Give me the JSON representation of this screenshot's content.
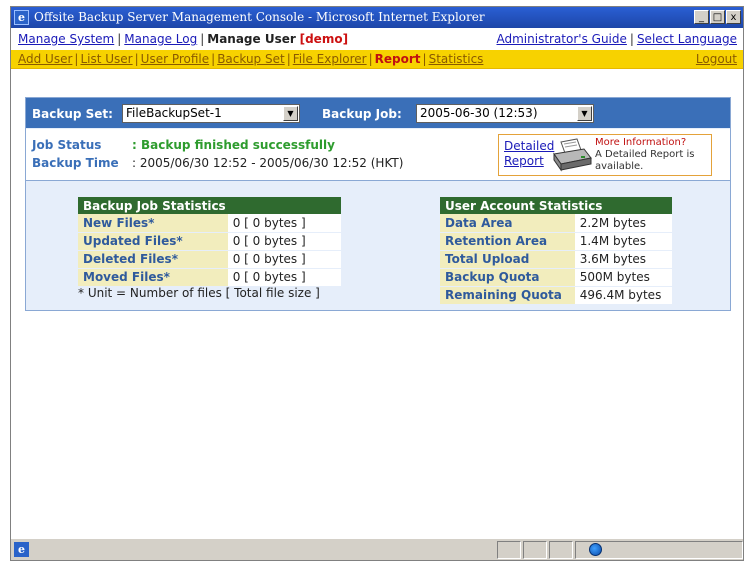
{
  "window": {
    "title": "Offsite Backup Server Management Console - Microsoft Internet Explorer",
    "controls": [
      "_",
      "□",
      "x"
    ]
  },
  "nav_top": {
    "manage_system": "Manage System",
    "manage_log": "Manage Log",
    "manage_user": "Manage User",
    "user": "demo",
    "admin_guide": "Administrator's Guide",
    "select_language": "Select Language"
  },
  "nav_sub": {
    "items": [
      "Add User",
      "List User",
      "User Profile",
      "Backup Set",
      "File Explorer",
      "Report",
      "Statistics"
    ],
    "active": "Report",
    "logout": "Logout"
  },
  "filters": {
    "backup_set_label": "Backup Set:",
    "backup_set_value": "FileBackupSet-1",
    "backup_job_label": "Backup Job:",
    "backup_job_value": "2005-06-30 (12:53)"
  },
  "status": {
    "job_status_label": "Job Status",
    "job_status_value": ": Backup finished successfully",
    "backup_time_label": "Backup Time",
    "backup_time_value": ": 2005/06/30 12:52 - 2005/06/30 12:52 (HKT)"
  },
  "detail": {
    "link_line1": "Detailed",
    "link_line2": "Report",
    "more_info": "More Information?",
    "desc": "A Detailed Report is available."
  },
  "job_stats": {
    "title": "Backup Job Statistics",
    "rows": [
      {
        "label": "New Files*",
        "value": "0 [ 0 bytes ]"
      },
      {
        "label": "Updated Files*",
        "value": "0 [ 0 bytes ]"
      },
      {
        "label": "Deleted Files*",
        "value": "0 [ 0 bytes ]"
      },
      {
        "label": "Moved Files*",
        "value": "0 [ 0 bytes ]"
      }
    ],
    "footnote": "* Unit = Number of files [ Total file size ]"
  },
  "account_stats": {
    "title": "User Account Statistics",
    "rows": [
      {
        "label": "Data Area",
        "value": "2.2M bytes"
      },
      {
        "label": "Retention Area",
        "value": "1.4M bytes"
      },
      {
        "label": "Total Upload",
        "value": "3.6M bytes"
      },
      {
        "label": "Backup Quota",
        "value": "500M bytes"
      },
      {
        "label": "Remaining Quota",
        "value": "496.4M bytes"
      }
    ]
  },
  "colors": {
    "title_bar": "#1d46a8",
    "sub_nav": "#f7d200",
    "panel_header": "#3a6fb8",
    "table_header": "#2f6a2f",
    "success": "#2e9c2e"
  }
}
